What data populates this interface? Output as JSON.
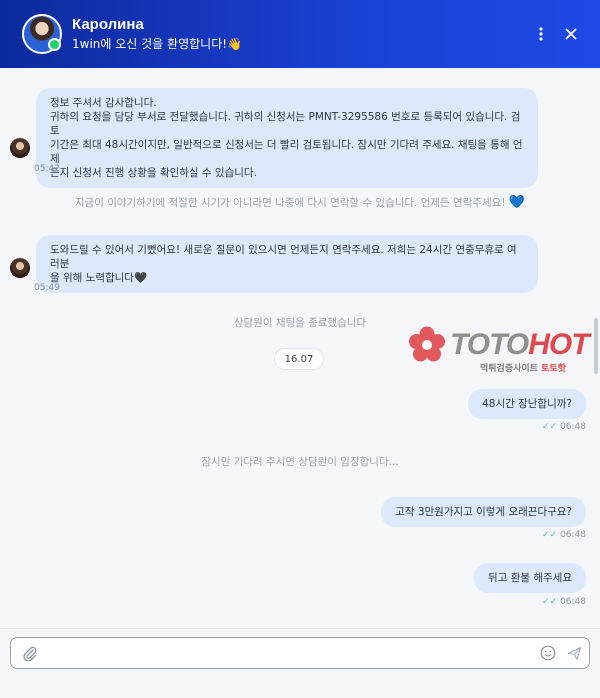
{
  "header": {
    "agent_name": "Каролина",
    "status": "1win에 오신 것을 환영합니다!👋",
    "menu_icon": "more-vertical-icon",
    "close_icon": "close-icon"
  },
  "messages": [
    {
      "side": "in",
      "lines": [
        "정보 주셔서 감사합니다.",
        "귀하의 요청을 담당 부서로 전달했습니다. 귀하의 신청서는 PMNT-3295586 번호로 등록되어 있습니다. 검토",
        "기간은 최대 48시간이지만, 일반적으로 신청서는 더 빨리 검토됩니다. 잠시만 기다려 주세요. 채팅을 통해 언제",
        "든지 신청서 진행 상황을 확인하실 수 있습니다."
      ],
      "time": "05:42"
    },
    {
      "side": "system",
      "text": "지금이 이야기하기에 적절한 시기가 아니라면 나중에 다시 연락할 수 있습니다. 언제든 연락주세요!",
      "emoji": "💙"
    },
    {
      "side": "in",
      "lines": [
        "도와드릴 수 있어서 기뻤어요! 새로운 질문이 있으시면 언제든지 연락주세요. 저희는 24시간 연중무휴로 여러분",
        "을 위해 노력합니다🖤"
      ],
      "time": "05:49"
    },
    {
      "side": "system",
      "text": "상담원이 채팅을 종료했습니다"
    },
    {
      "side": "date",
      "text": "16.07"
    },
    {
      "side": "out",
      "text": "48시간 장난합니까?",
      "time": "06:48",
      "check": "✓✓"
    },
    {
      "side": "system",
      "text": "잠시만 기다려 주시면 상담원이 입장합니다..."
    },
    {
      "side": "out",
      "text": "고작 3만원가지고 이렇게 오래끈다구요?",
      "time": "06:48",
      "check": "✓✓"
    },
    {
      "side": "out",
      "text": "뒤고 환불 해주세요",
      "time": "06:48",
      "check": "✓✓"
    }
  ],
  "watermark": {
    "brand_gray": "TOTO",
    "brand_red": "HOT",
    "sub_gray": "먹튀검증사이트",
    "sub_red": "토토핫",
    "colors": {
      "gray": "#8f8f8f",
      "red": "#e0484d"
    }
  },
  "composer": {
    "placeholder": "",
    "attach_icon": "paperclip-icon",
    "emoji_icon": "smiley-icon",
    "send_icon": "send-icon"
  },
  "colors": {
    "header_start": "#0b2a9c",
    "header_end": "#1f49e6",
    "bubble": "#dce9fb",
    "read_check": "#4db6e8"
  }
}
